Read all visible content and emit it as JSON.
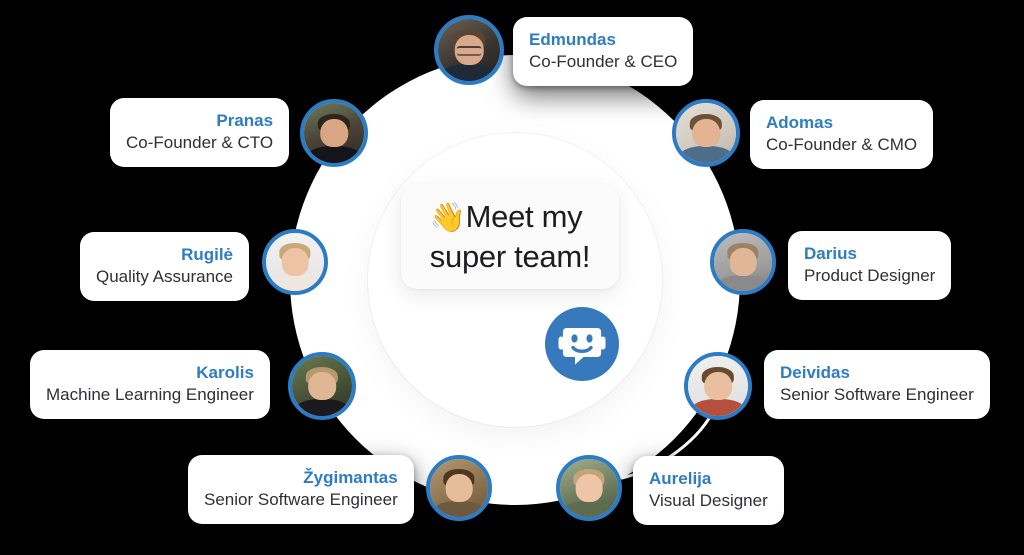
{
  "center": {
    "message_emoji": "👋",
    "message_text": "Meet my\nsuper team!",
    "bot_icon": "chatbot-icon"
  },
  "theme": {
    "background": "#000000",
    "accent_blue": "#2e7cc4",
    "avatar_ring": "#2b7cc4",
    "card_bg": "#ffffff",
    "role_text": "#2f3033",
    "hub_bg": "#ffffff"
  },
  "team": [
    {
      "id": "edmundas",
      "name": "Edmundas",
      "role": "Co-Founder & CEO",
      "avatar_alt": "edmundas-avatar"
    },
    {
      "id": "pranas",
      "name": "Pranas",
      "role": "Co-Founder & CTO",
      "avatar_alt": "pranas-avatar"
    },
    {
      "id": "adomas",
      "name": "Adomas",
      "role": "Co-Founder & CMO",
      "avatar_alt": "adomas-avatar"
    },
    {
      "id": "rugile",
      "name": "Rugilė",
      "role": "Quality Assurance",
      "avatar_alt": "rugile-avatar"
    },
    {
      "id": "darius",
      "name": "Darius",
      "role": "Product Designer",
      "avatar_alt": "darius-avatar"
    },
    {
      "id": "karolis",
      "name": "Karolis",
      "role": "Machine Learning Engineer",
      "avatar_alt": "karolis-avatar"
    },
    {
      "id": "deividas",
      "name": "Deividas",
      "role": "Senior Software Engineer",
      "avatar_alt": "deividas-avatar"
    },
    {
      "id": "zygimantas",
      "name": "Žygimantas",
      "role": "Senior Software Engineer",
      "avatar_alt": "zygimantas-avatar"
    },
    {
      "id": "aurelija",
      "name": "Aurelija",
      "role": "Visual Designer",
      "avatar_alt": "aurelija-avatar"
    }
  ]
}
